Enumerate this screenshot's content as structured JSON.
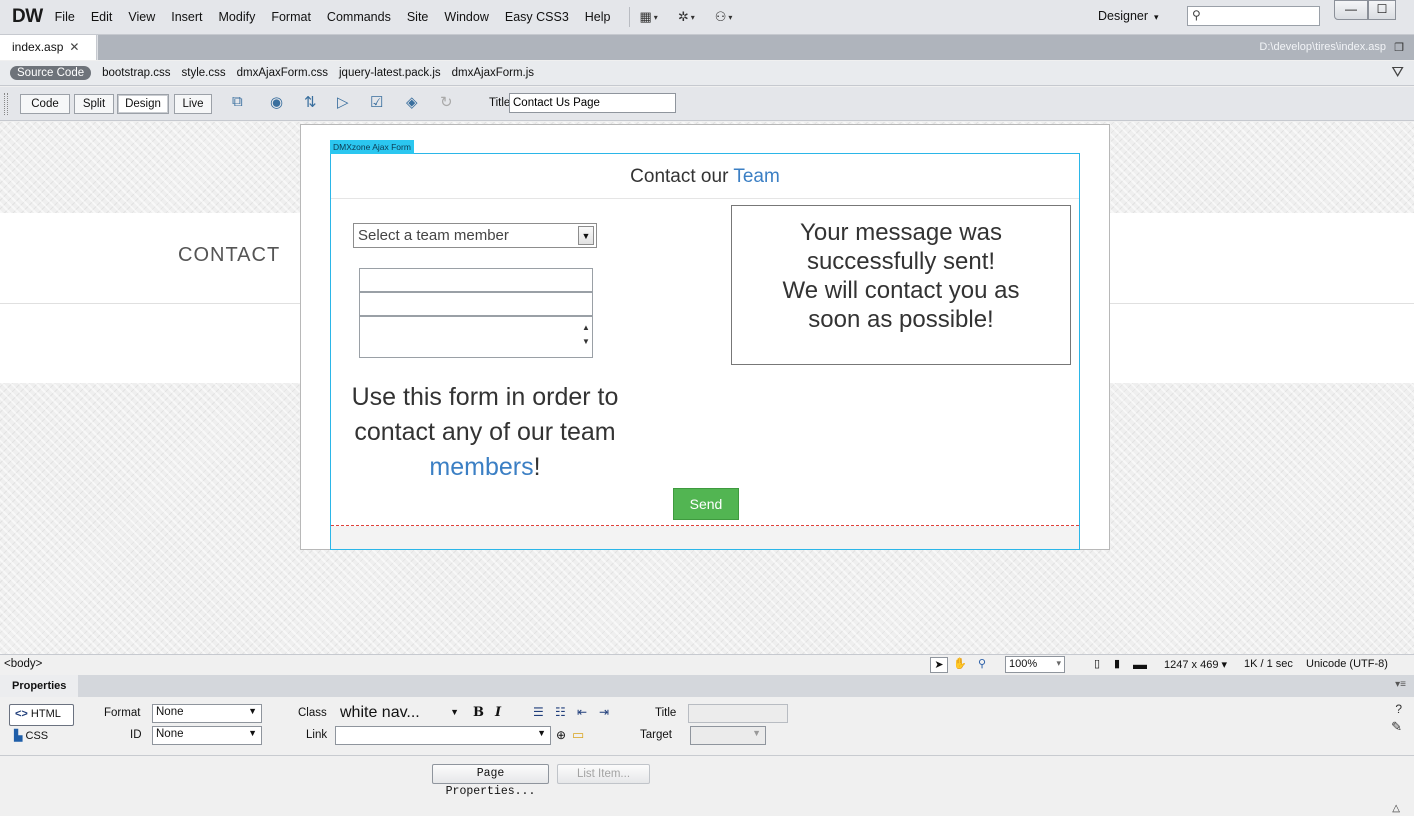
{
  "app": {
    "logo": "DW",
    "menu": [
      "File",
      "Edit",
      "View",
      "Insert",
      "Modify",
      "Format",
      "Commands",
      "Site",
      "Window",
      "Easy CSS3",
      "Help"
    ],
    "workspace": "Designer",
    "search_placeholder": ""
  },
  "document": {
    "tab_label": "index.asp",
    "path": "D:\\develop\\tires\\index.asp",
    "related_files": [
      "Source Code",
      "bootstrap.css",
      "style.css",
      "dmxAjaxForm.css",
      "jquery-latest.pack.js",
      "dmxAjaxForm.js"
    ]
  },
  "toolbar": {
    "views": [
      "Code",
      "Split",
      "Design",
      "Live"
    ],
    "active_view": "Design",
    "title_label": "Title:",
    "title_value": "Contact Us Page"
  },
  "canvas": {
    "nav_text": "CONTACT",
    "form_tag": "DMXzone Ajax Form",
    "form_title_pre": "Contact our",
    "form_title_accent": "Team",
    "select_placeholder": "Select a team member",
    "intro_line1": "Use this form in order to",
    "intro_line2": "contact any of our team",
    "intro_accent": "members",
    "intro_end": "!",
    "success_line1": "Your message was",
    "success_line2": "successfully sent!",
    "success_line3": "We will contact you as",
    "success_line4": "soon as possible!",
    "send_label": "Send"
  },
  "status": {
    "tag": "<body>",
    "zoom": "100%",
    "dimensions": "1247 x 469",
    "download": "1K / 1 sec",
    "encoding": "Unicode (UTF-8)"
  },
  "properties": {
    "header": "Properties",
    "html_mode": "HTML",
    "css_mode": "CSS",
    "format_label": "Format",
    "format_value": "None",
    "id_label": "ID",
    "id_value": "None",
    "class_label": "Class",
    "class_value": "white nav...",
    "link_label": "Link",
    "link_value": "",
    "title_label": "Title",
    "target_label": "Target",
    "page_props_button": "Page Properties...",
    "list_item_button": "List Item..."
  },
  "colors": {
    "accent_blue": "#3b7fc4",
    "form_outline": "#2bb6e8",
    "send_green": "#52b552"
  }
}
